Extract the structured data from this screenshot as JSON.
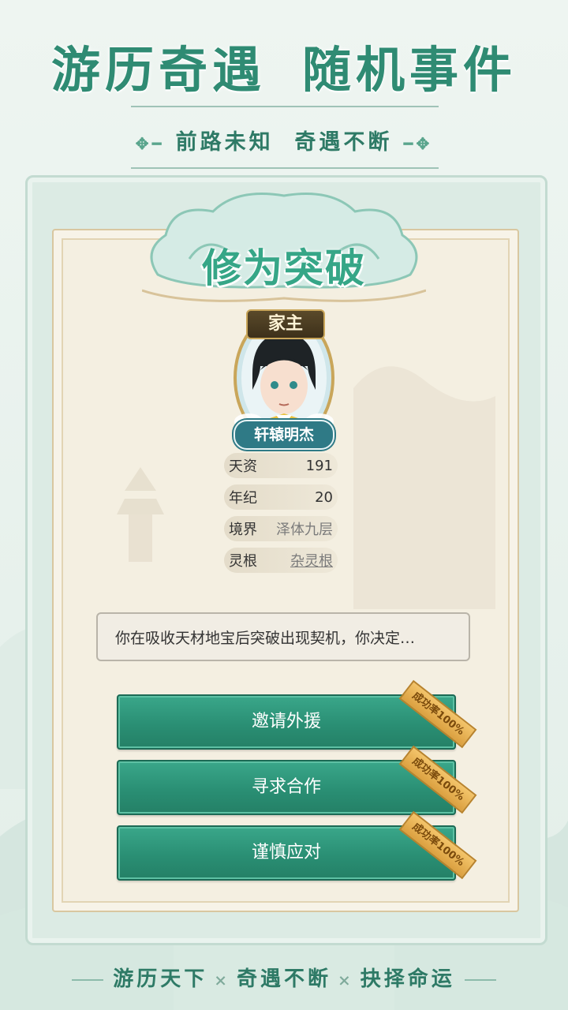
{
  "header": {
    "headline_left": "游历奇遇",
    "headline_right": "随机事件",
    "tagline_left": "前路未知",
    "tagline_right": "奇遇不断"
  },
  "panel": {
    "title": "修为突破",
    "character": {
      "rank": "家主",
      "name": "轩辕明杰"
    },
    "stats": [
      {
        "label": "天资",
        "value": "191"
      },
      {
        "label": "年纪",
        "value": "20"
      },
      {
        "label": "境界",
        "value": "泽体九层"
      },
      {
        "label": "灵根",
        "value": "杂灵根"
      }
    ],
    "prompt": "你在吸收天材地宝后突破出现契机，你决定…",
    "choices": [
      {
        "label": "邀请外援",
        "badge": "成功率100%"
      },
      {
        "label": "寻求合作",
        "badge": "成功率100%"
      },
      {
        "label": "谨慎应对",
        "badge": "成功率100%"
      }
    ]
  },
  "footer": {
    "part1": "游历天下",
    "part2": "奇遇不断",
    "part3": "抉择命运",
    "separator": "×"
  },
  "colors": {
    "accent_green": "#2f8b73",
    "button_green": "#2a8f74",
    "paper": "#f4efe1",
    "badge_gold": "#e0a648"
  }
}
